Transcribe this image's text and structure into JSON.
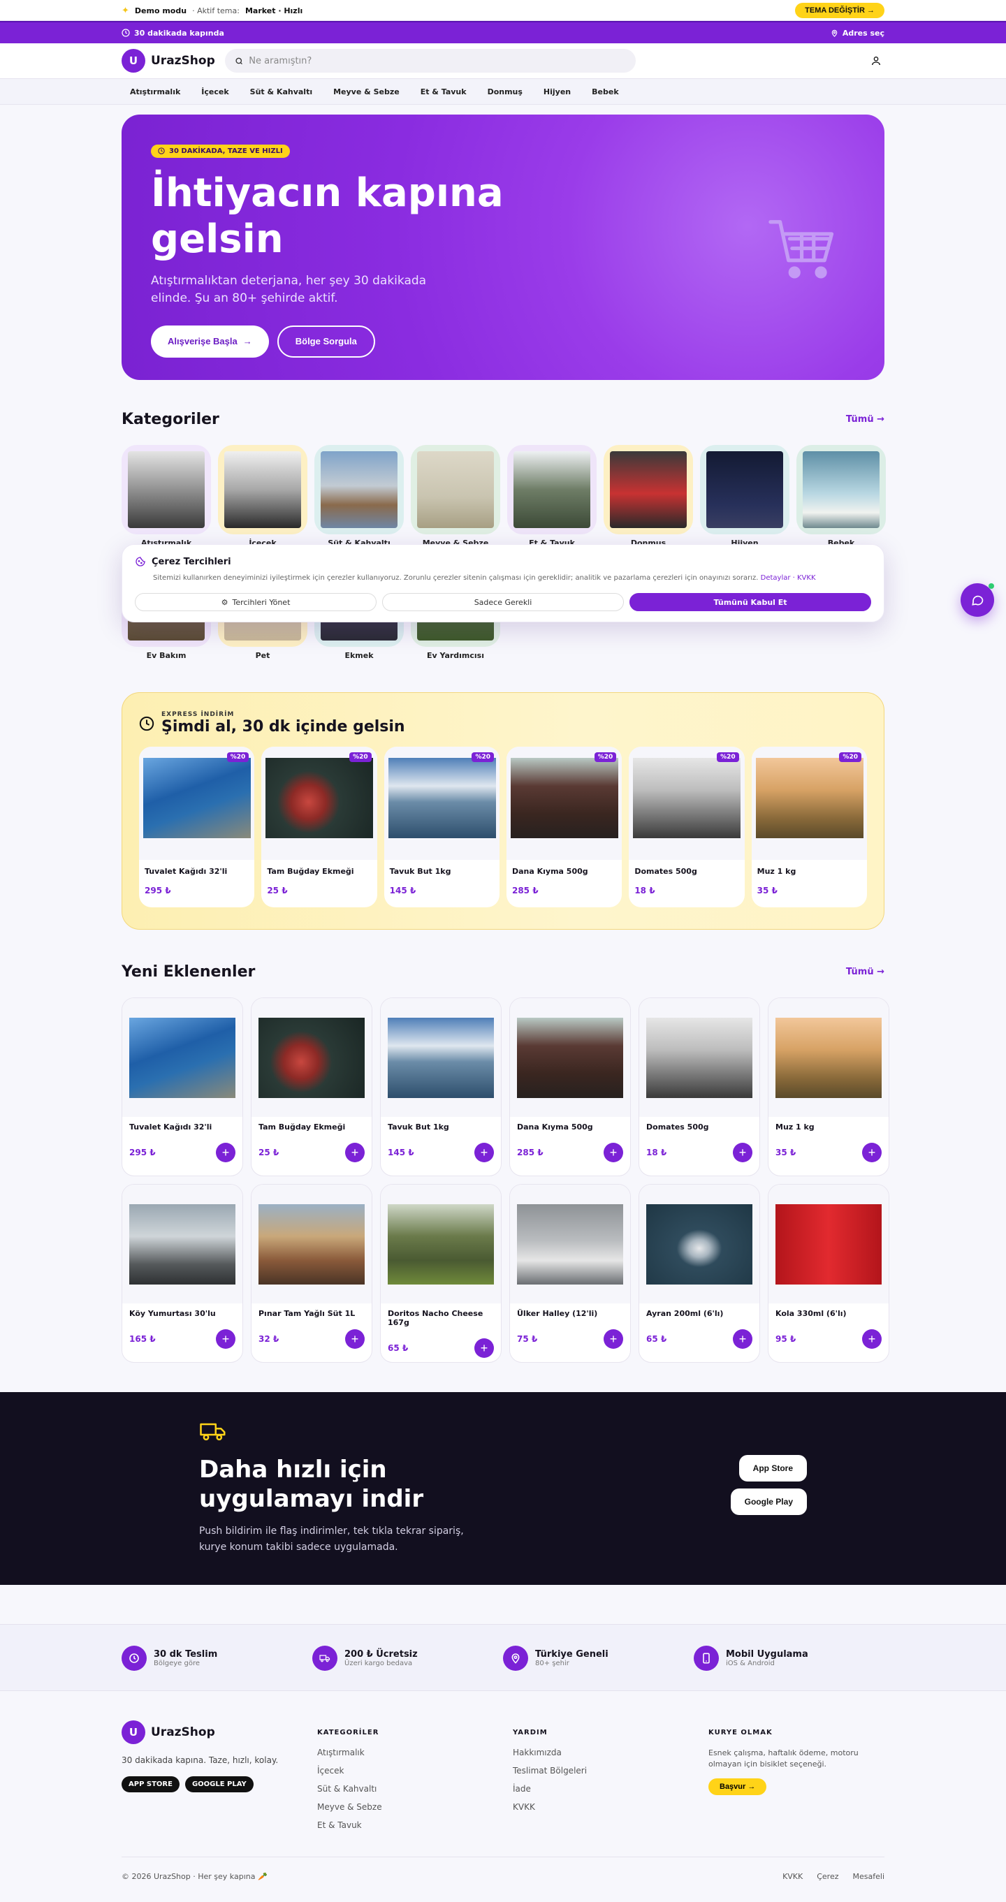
{
  "demo": {
    "icon": "sparkle-icon",
    "mode": "Demo modu",
    "theme_prefix": "· Aktif tema:",
    "theme_name": "Market · Hızlı",
    "theme_button": "TEMA DEĞİŞTİR →"
  },
  "strip": {
    "delivery": "30 dakikada kapında",
    "address": "Adres seç"
  },
  "header": {
    "logo_mark": "U",
    "logo_text": "UrazShop",
    "search_placeholder": "Ne aramıştın?"
  },
  "nav": [
    "Atıştırmalık",
    "İçecek",
    "Süt & Kahvaltı",
    "Meyve & Sebze",
    "Et & Tavuk",
    "Donmuş",
    "Hijyen",
    "Bebek"
  ],
  "hero": {
    "badge": "30 DAKİKADA, TAZE VE HIZLI",
    "title": "İhtiyacın kapına gelsin",
    "subtitle": "Atıştırmalıktan deterjana, her şey 30 dakikada elinde. Şu an 80+ şehirde aktif.",
    "primary_cta": "Alışverişe Başla",
    "secondary_cta": "Bölge Sorgula"
  },
  "categories": {
    "title": "Kategoriler",
    "link": "Tümü →",
    "row1": [
      {
        "label": "Atıştırmalık",
        "bg": "#f0e6fb",
        "img": "linear-gradient(180deg,#e4e4e4 0%,#9a9a9a 45%,#3a3a3a 100%)"
      },
      {
        "label": "İçecek",
        "bg": "#fdf0c4",
        "img": "linear-gradient(180deg,#f0f0f0 0%,#a8a8a8 50%,#2a2a2a 100%)"
      },
      {
        "label": "Süt & Kahvaltı",
        "bg": "#dcefef",
        "img": "linear-gradient(180deg,#7fa3c9 0%,#c2cbd3 45%,#8a6a4c 70%,#6f86a5 100%)"
      },
      {
        "label": "Meyve & Sebze",
        "bg": "#e0efe3",
        "img": "linear-gradient(180deg,#ddd8c8 0%,#c9c4b0 60%,#a79f83 100%)"
      },
      {
        "label": "Et & Tavuk",
        "bg": "#efe5f9",
        "img": "linear-gradient(180deg,#eef1f3 0%,#6e7d66 50%,#3c4a37 100%)"
      },
      {
        "label": "Donmuş",
        "bg": "#fdf0c4",
        "img": "linear-gradient(180deg,#3a3a3a 0%,#c83232 55%,#2a2a2a 100%)"
      },
      {
        "label": "Hijyen",
        "bg": "#dcefef",
        "img": "linear-gradient(180deg,#131a33 0%,#27305a 70%,#3a3f62 100%)"
      },
      {
        "label": "Bebek",
        "bg": "#dceee6",
        "img": "linear-gradient(180deg,#5e8fa6 0%,#b8d7e2 55%,#f0f2ef 80%,#6f8a8f 100%)"
      }
    ],
    "row2": [
      {
        "label": "Ev Bakım",
        "bg": "#efe5f9",
        "img": "linear-gradient(180deg,#9b8a66 0%,#5b4c35 100%)"
      },
      {
        "label": "Pet",
        "bg": "#fdf0c4",
        "img": "linear-gradient(180deg,#e7dcc8 0%,#c8b897 100%)"
      },
      {
        "label": "Ekmek",
        "bg": "#dcefef",
        "img": "linear-gradient(180deg,#5a5a6a 0%,#2b2b35 100%)"
      },
      {
        "label": "Ev Yardımcısı",
        "bg": "#e0efe3",
        "img": "linear-gradient(180deg,#6a8a4a 0%,#3e5a2a 100%)"
      }
    ]
  },
  "cookie": {
    "title": "Çerez Tercihleri",
    "text": "Sitemizi kullanırken deneyiminizi iyileştirmek için çerezler kullanıyoruz. Zorunlu çerezler sitenin çalışması için gereklidir; analitik ve pazarlama çerezleri için onayınızı sorarız.",
    "link": "Detaylar · KVKK",
    "manage": "Tercihleri Yönet",
    "necessary": "Sadece Gerekli",
    "accept": "Tümünü Kabul Et"
  },
  "express": {
    "kicker": "EXPRESS İNDİRİM",
    "title": "Şimdi al, 30 dk içinde gelsin",
    "items": [
      {
        "name": "Tuvalet Kağıdı 32'li",
        "price": "295 ₺",
        "discount": "%20",
        "img": "linear-gradient(160deg,#6aa6e0 0%,#1f5fa8 40%,#2a6fb0 60%,#8a8a7a 100%)"
      },
      {
        "name": "Tam Buğday Ekmeği",
        "price": "25 ₺",
        "discount": "%20",
        "img": "radial-gradient(circle at 40% 55%,#c8473f 0%,#8d2a26 22%,#2a3a36 40%,#1a2624 100%)"
      },
      {
        "name": "Tavuk But 1kg",
        "price": "145 ₺",
        "discount": "%20",
        "img": "linear-gradient(180deg,#4f7fb8 0%,#dfe7ef 35%,#6b8ca8 55%,#2d4e6c 100%)"
      },
      {
        "name": "Dana Kıyma 500g",
        "price": "285 ₺",
        "discount": "%20",
        "img": "linear-gradient(180deg,#b9c9c4 0%,#5a3a34 35%,#3a2620 70%,#27211f 100%)"
      },
      {
        "name": "Domates 500g",
        "price": "18 ₺",
        "discount": "%20",
        "img": "linear-gradient(180deg,#e6e6e6 0%,#bdbdbd 40%,#707070 75%,#3a3a3a 100%)"
      },
      {
        "name": "Muz 1 kg",
        "price": "35 ₺",
        "discount": "%20",
        "img": "linear-gradient(180deg,#f2c79a 0%,#d7a265 40%,#8a6a3a 75%,#5a4a2a 100%)"
      }
    ]
  },
  "new_products": {
    "title": "Yeni Eklenenler",
    "link": "Tümü →",
    "items": [
      {
        "name": "Tuvalet Kağıdı 32'li",
        "price": "295 ₺",
        "img": "linear-gradient(160deg,#6aa6e0 0%,#1f5fa8 40%,#2a6fb0 60%,#8a8a7a 100%)"
      },
      {
        "name": "Tam Buğday Ekmeği",
        "price": "25 ₺",
        "img": "radial-gradient(circle at 40% 55%,#c8473f 0%,#8d2a26 22%,#2a3a36 40%,#1a2624 100%)"
      },
      {
        "name": "Tavuk But 1kg",
        "price": "145 ₺",
        "img": "linear-gradient(180deg,#4f7fb8 0%,#dfe7ef 35%,#6b8ca8 55%,#2d4e6c 100%)"
      },
      {
        "name": "Dana Kıyma 500g",
        "price": "285 ₺",
        "img": "linear-gradient(180deg,#b9c9c4 0%,#5a3a34 35%,#3a2620 70%,#27211f 100%)"
      },
      {
        "name": "Domates 500g",
        "price": "18 ₺",
        "img": "linear-gradient(180deg,#e6e6e6 0%,#bdbdbd 40%,#707070 75%,#3a3a3a 100%)"
      },
      {
        "name": "Muz 1 kg",
        "price": "35 ₺",
        "img": "linear-gradient(180deg,#f2c79a 0%,#d7a265 40%,#8a6a3a 75%,#5a4a2a 100%)"
      },
      {
        "name": "Köy Yumurtası 30'lu",
        "price": "165 ₺",
        "img": "linear-gradient(180deg,#9aa7b2 0%,#cfd5d9 40%,#55595b 75%,#2e3133 100%)"
      },
      {
        "name": "Pınar Tam Yağlı Süt 1L",
        "price": "32 ₺",
        "img": "linear-gradient(180deg,#9ab0c4 0%,#c9a87a 40%,#8a5a3a 70%,#4a3426 100%)"
      },
      {
        "name": "Doritos Nacho Cheese 167g",
        "price": "65 ₺",
        "img": "linear-gradient(180deg,#cfd8c8 0%,#6a7a4a 40%,#4a5a32 70%,#6f8a3a 100%)"
      },
      {
        "name": "Ülker Halley (12'li)",
        "price": "75 ₺",
        "img": "linear-gradient(180deg,#8e9296 0%,#b9bcbf 45%,#e6e6e6 70%,#6a6e72 100%)"
      },
      {
        "name": "Ayran 200ml (6'lı)",
        "price": "65 ₺",
        "img": "radial-gradient(ellipse at 50% 55%,#e6e8ea 0%,#a9b6c0 14%,#2f4b5c 30%,#1f3745 100%)"
      },
      {
        "name": "Kola 330ml (6'lı)",
        "price": "95 ₺",
        "img": "linear-gradient(90deg,#b3151b 0%,#e22a2f 50%,#b3151b 100%)"
      }
    ]
  },
  "app_banner": {
    "title": "Daha hızlı için uygulamayı indir",
    "text": "Push bildirim ile flaş indirimler, tek tıkla tekrar sipariş, kurye konum takibi sadece uygulamada.",
    "app_store": "App Store",
    "google_play": "Google Play"
  },
  "features": [
    {
      "title": "30 dk Teslim",
      "sub": "Bölgeye göre",
      "icon": "clock-icon"
    },
    {
      "title": "200 ₺ Ücretsiz",
      "sub": "Üzeri kargo bedava",
      "icon": "truck-icon"
    },
    {
      "title": "Türkiye Geneli",
      "sub": "80+ şehir",
      "icon": "pin-icon"
    },
    {
      "title": "Mobil Uygulama",
      "sub": "iOS & Android",
      "icon": "phone-icon"
    }
  ],
  "footer": {
    "logo_mark": "U",
    "logo_text": "UrazShop",
    "desc": "30 dakikada kapına. Taze, hızlı, kolay.",
    "app_store": "APP STORE",
    "google_play": "GOOGLE PLAY",
    "categories_title": "KATEGORİLER",
    "categories": [
      "Atıştırmalık",
      "İçecek",
      "Süt & Kahvaltı",
      "Meyve & Sebze",
      "Et & Tavuk"
    ],
    "help_title": "YARDIM",
    "help": [
      "Hakkımızda",
      "Teslimat Bölgeleri",
      "İade",
      "KVKK"
    ],
    "courier_title": "KURYE OLMAK",
    "courier_text": "Esnek çalışma, haftalık ödeme, motoru olmayan için bisiklet seçeneği.",
    "courier_btn": "Başvur →",
    "copyright": "© 2026 UrazShop · Her şey kapına 🥕",
    "legal": [
      "KVKK",
      "Çerez",
      "Mesafeli"
    ]
  },
  "colors": {
    "primary": "#7b22d6",
    "accent": "#ffd318",
    "dark": "#120f1f"
  }
}
